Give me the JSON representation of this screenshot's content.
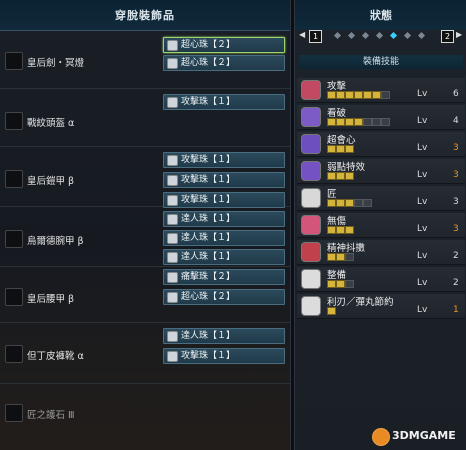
{
  "left_panel": {
    "title": "穿脫裝飾品",
    "equipment": [
      {
        "name": "皇后劍・冥燈",
        "icon": "sword-icon"
      },
      {
        "name": "戰紋頭盔 α",
        "icon": "helmet-icon"
      },
      {
        "name": "皇后鎧甲 β",
        "icon": "chest-armor-icon"
      },
      {
        "name": "烏爾德腕甲 β",
        "icon": "arm-armor-icon"
      },
      {
        "name": "皇后腰甲 β",
        "icon": "waist-armor-icon"
      },
      {
        "name": "但丁皮褲靴 α",
        "icon": "leg-armor-icon"
      },
      {
        "name": "匠之護石 Ⅲ",
        "icon": "charm-icon"
      }
    ],
    "slots": [
      {
        "label": "超心珠【２】"
      },
      {
        "label": "超心珠【２】"
      },
      {
        "label": "攻擊珠【１】"
      },
      {
        "label": "攻擊珠【１】"
      },
      {
        "label": "攻擊珠【１】"
      },
      {
        "label": "攻擊珠【１】"
      },
      {
        "label": "達人珠【１】"
      },
      {
        "label": "達人珠【１】"
      },
      {
        "label": "達人珠【１】"
      },
      {
        "label": "痛擊珠【２】"
      },
      {
        "label": "超心珠【２】"
      },
      {
        "label": "達人珠【１】"
      },
      {
        "label": "攻擊珠【１】"
      }
    ]
  },
  "right_panel": {
    "title": "狀態",
    "pager": {
      "left_page": "1",
      "right_page": "2",
      "left_arrow": "◀",
      "right_arrow": "▶",
      "active_dot": 3
    },
    "skills_header": "裝備技能",
    "level_label": "Lv",
    "skills": [
      {
        "name": "攻擊",
        "level": "6",
        "filled": 6,
        "max": 7,
        "at_max": false,
        "color": "#c14a62",
        "icon": "attack-skill-icon"
      },
      {
        "name": "看破",
        "level": "4",
        "filled": 4,
        "max": 7,
        "at_max": false,
        "color": "#7d5bc7",
        "icon": "critical-eye-skill-icon"
      },
      {
        "name": "超會心",
        "level": "3",
        "filled": 3,
        "max": 3,
        "at_max": true,
        "color": "#6d4fbf",
        "icon": "critical-boost-skill-icon"
      },
      {
        "name": "弱點特效",
        "level": "3",
        "filled": 3,
        "max": 3,
        "at_max": true,
        "color": "#7452c4",
        "icon": "weakness-exploit-skill-icon"
      },
      {
        "name": "匠",
        "level": "3",
        "filled": 3,
        "max": 5,
        "at_max": false,
        "color": "#d8d8d8",
        "icon": "handicraft-skill-icon"
      },
      {
        "name": "無傷",
        "level": "3",
        "filled": 3,
        "max": 3,
        "at_max": true,
        "color": "#d4557a",
        "icon": "peak-performance-skill-icon"
      },
      {
        "name": "精神抖擻",
        "level": "2",
        "filled": 2,
        "max": 3,
        "at_max": false,
        "color": "#c0404c",
        "icon": "agitator-skill-icon"
      },
      {
        "name": "整備",
        "level": "2",
        "filled": 2,
        "max": 3,
        "at_max": false,
        "color": "#dcdcdc",
        "icon": "maintenance-skill-icon"
      },
      {
        "name": "利刃／彈丸節約",
        "level": "1",
        "filled": 1,
        "max": 1,
        "at_max": true,
        "color": "#dcdcdc",
        "icon": "speed-sharpening-skill-icon"
      }
    ]
  },
  "watermark": {
    "text": "3DMGAME"
  },
  "colors": {
    "slot_bg": "#203a4a",
    "slot_selected_border": "#9bd46a",
    "pip_on": "#d4b43a",
    "level_max": "#e8952e",
    "pager_active": "#39d0ff"
  }
}
